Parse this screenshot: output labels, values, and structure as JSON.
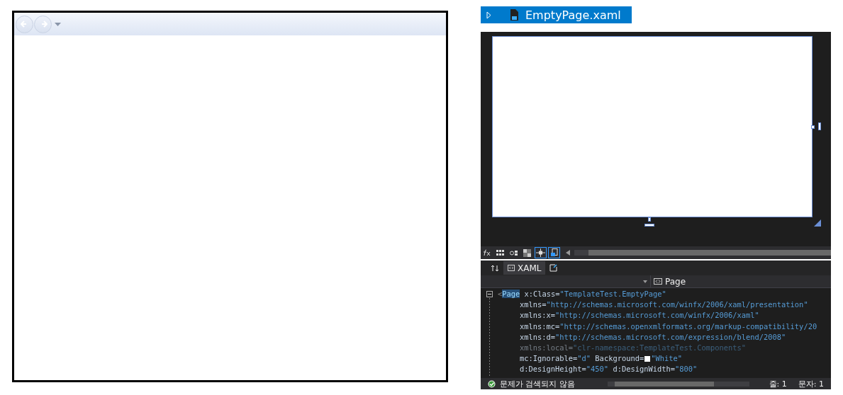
{
  "browser_frame": {
    "nav_buttons": [
      {
        "kind": "back",
        "disabled": true
      },
      {
        "kind": "forward",
        "disabled": true
      }
    ]
  },
  "document_tab": {
    "title": "EmptyPage.xaml",
    "selected": true
  },
  "design_toolbar": [
    {
      "kind": "fx",
      "selected": false
    },
    {
      "kind": "grid",
      "selected": false
    },
    {
      "kind": "gear-grid",
      "selected": false
    },
    {
      "kind": "checker",
      "selected": false
    },
    {
      "kind": "snap",
      "selected": true
    },
    {
      "kind": "device",
      "selected": true
    }
  ],
  "view_tabs": [
    {
      "label": "XAML",
      "selected": true
    }
  ],
  "element_dropdown": {
    "value": "Page"
  },
  "code_lines": [
    {
      "dimmed": false,
      "runs": [
        {
          "kind": "text",
          "tokens": [
            {
              "text": "<",
              "kind": "punct"
            },
            {
              "text": "Page",
              "kind": "element"
            },
            {
              "text": " x:Class=",
              "kind": "attr"
            },
            {
              "text": "\"TemplateTest.EmptyPage\"",
              "kind": "value"
            }
          ]
        }
      ]
    },
    {
      "dimmed": false,
      "runs": [
        {
          "kind": "text",
          "tokens": [
            {
              "text": "xmlns=",
              "kind": "attr"
            },
            {
              "text": "\"http://schemas.microsoft.com/winfx/2006/xaml/presentation\"",
              "kind": "value"
            }
          ]
        }
      ]
    },
    {
      "dimmed": false,
      "runs": [
        {
          "kind": "text",
          "tokens": [
            {
              "text": "xmlns:x=",
              "kind": "attr"
            },
            {
              "text": "\"http://schemas.microsoft.com/winfx/2006/xaml\"",
              "kind": "value"
            }
          ]
        }
      ]
    },
    {
      "dimmed": false,
      "runs": [
        {
          "kind": "text",
          "tokens": [
            {
              "text": "xmlns:mc=",
              "kind": "attr"
            },
            {
              "text": "\"http://schemas.openxmlformats.org/markup-compatibility/20",
              "kind": "value"
            }
          ]
        }
      ]
    },
    {
      "dimmed": false,
      "runs": [
        {
          "kind": "text",
          "tokens": [
            {
              "text": "xmlns:d=",
              "kind": "attr"
            },
            {
              "text": "\"http://schemas.microsoft.com/expression/blend/2008\"",
              "kind": "value"
            }
          ]
        }
      ]
    },
    {
      "dimmed": true,
      "runs": [
        {
          "kind": "text",
          "tokens": [
            {
              "text": "xmlns:local=",
              "kind": "attr"
            },
            {
              "text": "\"clr-namespace:TemplateTest.Components\"",
              "kind": "value"
            }
          ]
        }
      ]
    },
    {
      "dimmed": false,
      "runs": [
        {
          "kind": "text",
          "tokens": [
            {
              "text": "mc:Ignorable=",
              "kind": "attr"
            },
            {
              "text": "\"d\"",
              "kind": "value"
            },
            {
              "text": " Background=",
              "kind": "attr"
            }
          ]
        },
        {
          "kind": "swatch",
          "color": "#ffffff"
        },
        {
          "kind": "text",
          "tokens": [
            {
              "text": "\"White\"",
              "kind": "value"
            }
          ]
        }
      ]
    },
    {
      "dimmed": false,
      "runs": [
        {
          "kind": "text",
          "tokens": [
            {
              "text": "d:DesignHeight=",
              "kind": "attr"
            },
            {
              "text": "\"450\"",
              "kind": "value"
            },
            {
              "text": " d:DesignWidth=",
              "kind": "attr"
            },
            {
              "text": "\"800\"",
              "kind": "value"
            }
          ]
        }
      ]
    }
  ],
  "status_bar": {
    "message": "문제가 검색되지 않음",
    "line": "줄: 1",
    "column": "문자: 1"
  }
}
